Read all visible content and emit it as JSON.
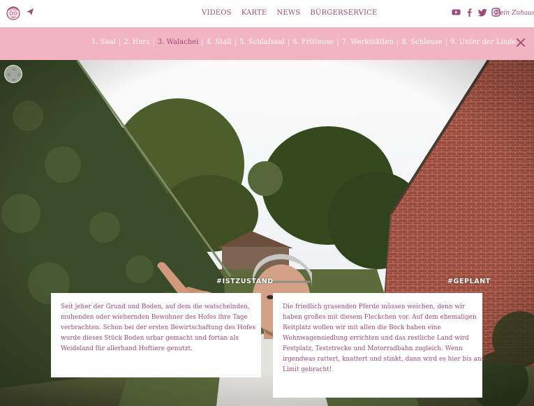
{
  "nav": {
    "menu": [
      "VIDEOS",
      "KARTE",
      "NEWS",
      "BÜRGERSERVICE"
    ],
    "tagline": "Dein Zuhause",
    "icons": [
      "logo-mascot",
      "send-icon",
      "youtube-icon",
      "facebook-icon",
      "twitter-icon",
      "instagram-icon"
    ]
  },
  "chapters": {
    "items": [
      "1. Saal",
      "2. Herz",
      "3. Walachei",
      "4. Stall",
      "5. Schlafsaal",
      "6. Fritteuse",
      "7. Werkstätten",
      "8. Schleuse",
      "9. Unter der Linde"
    ],
    "active_index": 2,
    "separator": "|"
  },
  "scene": {
    "hashtag_left": "#ISTZUSTAND",
    "hashtag_right": "#GEPLANT"
  },
  "cards": {
    "left": [
      "Seit jeher der Grund und Boden, auf dem die watschelnden,",
      "muhenden oder wiehernden Bewohner des Hofes ihre Tage",
      "verbrachten. Schon bei der ersten Bewirtschaftung des Hofes",
      "wurde dieses Stück Boden urbar gemacht und fortan als",
      "Weideland für allerhand Hoftiere genutzt."
    ],
    "right": [
      "Die friedlich grasenden Pferde müssen weichen, denn wir",
      "haben großes mit diesem Fleckchen vor. Auf dem ehemaligen",
      "Reitplatz wollen wir mit allen die Bock haben eine",
      "Wohnwagensiedlung errichten und das restliche Land wird",
      "Festplatz, Teststrecke und Motorradbahn zugleich. Wenn",
      "irgendwas rattert, knattert und stinkt, dann wird es hier bis ans",
      "Limit gebracht!"
    ]
  },
  "colors": {
    "brand": "#9c4a7a",
    "chapter_bar": "#f2b4c3",
    "text_on_bar": "#ffffff"
  }
}
